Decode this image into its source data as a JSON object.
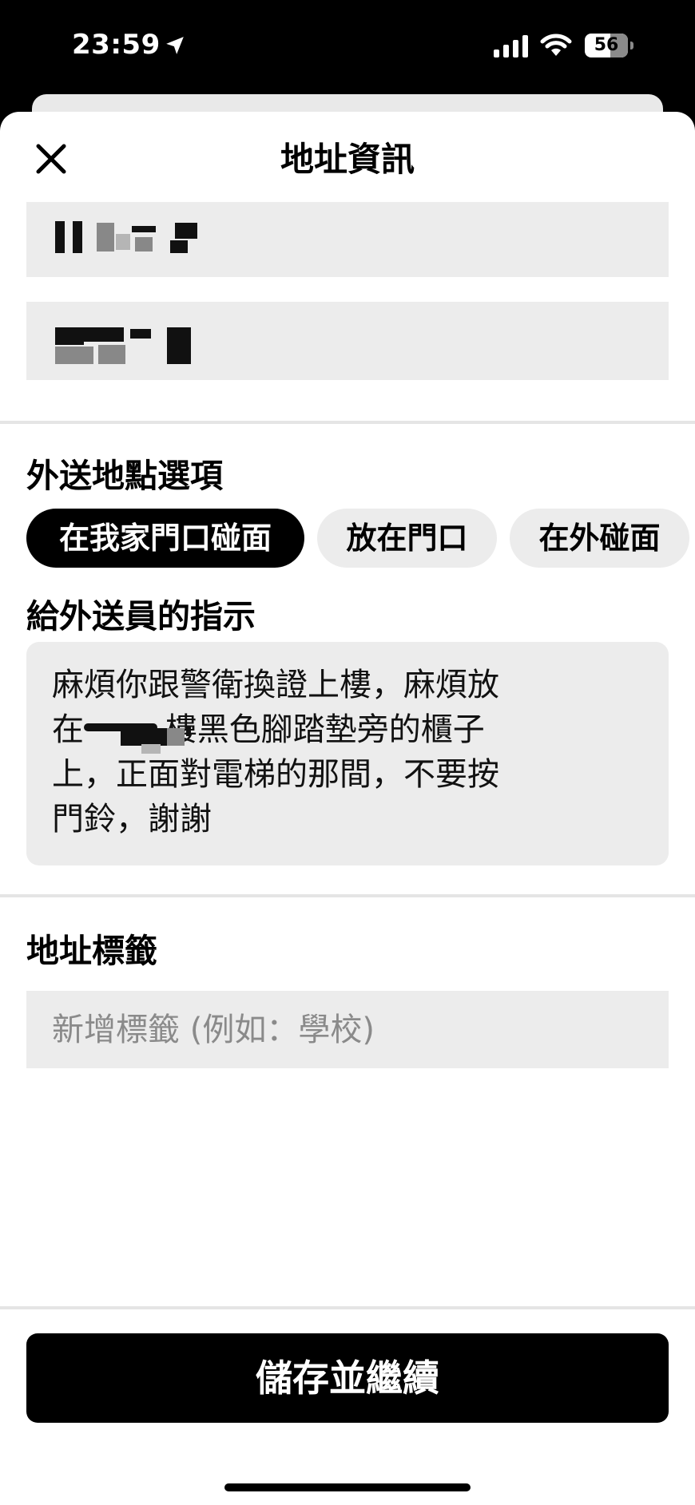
{
  "status_bar": {
    "time": "23:59",
    "battery": "56"
  },
  "header": {
    "title": "地址資訊"
  },
  "delivery_options": {
    "title": "外送地點選項",
    "chips": [
      {
        "label": "在我家門口碰面",
        "selected": true
      },
      {
        "label": "放在門口",
        "selected": false
      },
      {
        "label": "在外碰面",
        "selected": false
      }
    ]
  },
  "instructions": {
    "title": "給外送員的指示",
    "text": "麻煩你跟警衛換證上樓，麻煩放\n在        樓黑色腳踏墊旁的櫃子\n上，正面對電梯的那間，不要按\n門鈴，謝謝"
  },
  "address_label": {
    "title": "地址標籤",
    "placeholder": "新增標籤 (例如：學校)",
    "value": ""
  },
  "footer": {
    "save_label": "儲存並繼續"
  },
  "colors": {
    "primary": "#000000",
    "field_bg": "#ececec",
    "divider": "#e5e5e5"
  }
}
